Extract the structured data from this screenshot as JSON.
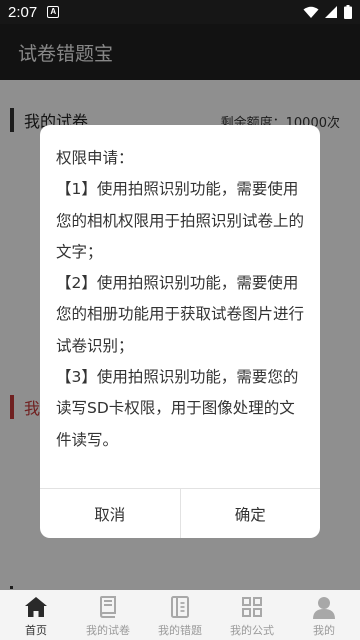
{
  "status_bar": {
    "time": "2:07",
    "notification_glyph": "A"
  },
  "app": {
    "title": "试卷错题宝"
  },
  "content": {
    "section_my_papers": "我的试卷",
    "remaining_quota": "剩余额度：10000次",
    "section_second_partial": "我"
  },
  "dialog": {
    "title": "权限申请：",
    "items": [
      "【1】使用拍照识别功能，需要使用您的相机权限用于拍照识别试卷上的文字；",
      "【2】使用拍照识别功能，需要使用您的相册功能用于获取试卷图片进行试卷识别；",
      "【3】使用拍照识别功能，需要您的读写SD卡权限，用于图像处理的文件读写。"
    ],
    "cancel_label": "取消",
    "confirm_label": "确定"
  },
  "tabs": [
    {
      "label": "首页",
      "icon": "home-icon",
      "active": true
    },
    {
      "label": "我的试卷",
      "icon": "book-icon",
      "active": false
    },
    {
      "label": "我的错题",
      "icon": "notebook-icon",
      "active": false
    },
    {
      "label": "我的公式",
      "icon": "grid-icon",
      "active": false
    },
    {
      "label": "我的",
      "icon": "person-icon",
      "active": false
    }
  ],
  "colors": {
    "accent_red": "#c23a3a",
    "appbar": "#202020",
    "statusbar": "#161616"
  }
}
